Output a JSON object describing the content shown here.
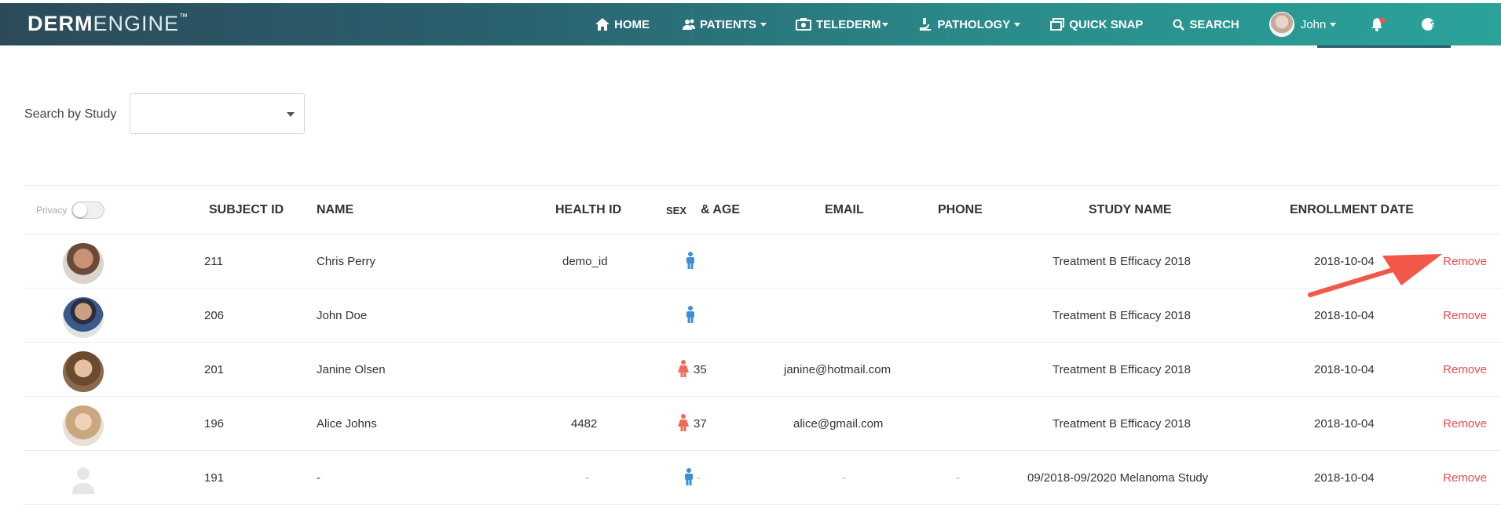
{
  "brand": {
    "bold": "DERM",
    "light": "ENGINE",
    "tm": "™"
  },
  "nav": {
    "home": "HOME",
    "patients": "PATIENTS",
    "telederm": "TELEDERM",
    "pathology": "PATHOLOGY",
    "quick_snap": "QUICK SNAP",
    "search": "SEARCH",
    "user": "John",
    "help": "?"
  },
  "search": {
    "label": "Search by Study",
    "value": ""
  },
  "table": {
    "privacy_label": "Privacy",
    "headers": {
      "subject_id": "SUBJECT ID",
      "name": "NAME",
      "health_id": "HEALTH ID",
      "sex": "SEX",
      "age": "& AGE",
      "email": "EMAIL",
      "phone": "PHONE",
      "study_name": "STUDY NAME",
      "enrollment_date": "ENROLLMENT DATE"
    },
    "rows": [
      {
        "subject_id": "211",
        "name": "Chris Perry",
        "health_id": "demo_id",
        "sex": "male",
        "age": "",
        "email": "",
        "phone": "",
        "study": "Treatment B Efficacy 2018",
        "date": "2018-10-04",
        "action": "Remove"
      },
      {
        "subject_id": "206",
        "name": "John Doe",
        "health_id": "",
        "sex": "male",
        "age": "",
        "email": "",
        "phone": "",
        "study": "Treatment B Efficacy 2018",
        "date": "2018-10-04",
        "action": "Remove"
      },
      {
        "subject_id": "201",
        "name": "Janine Olsen",
        "health_id": "",
        "sex": "female",
        "age": "35",
        "email": "janine@hotmail.com",
        "phone": "",
        "study": "Treatment B Efficacy 2018",
        "date": "2018-10-04",
        "action": "Remove"
      },
      {
        "subject_id": "196",
        "name": "Alice Johns",
        "health_id": "4482",
        "sex": "female",
        "age": "37",
        "email": "alice@gmail.com",
        "phone": "",
        "study": "Treatment B Efficacy 2018",
        "date": "2018-10-04",
        "action": "Remove"
      },
      {
        "subject_id": "191",
        "name": "-",
        "health_id": "-",
        "sex": "male",
        "age": "-",
        "email": "-",
        "phone": "-",
        "study": "09/2018-09/2020 Melanoma Study",
        "date": "2018-10-04",
        "action": "Remove"
      }
    ]
  },
  "colors": {
    "male": "#3b8fd6",
    "female": "#f06a5a",
    "remove": "#e84d4d",
    "arrow": "#f2584a"
  }
}
